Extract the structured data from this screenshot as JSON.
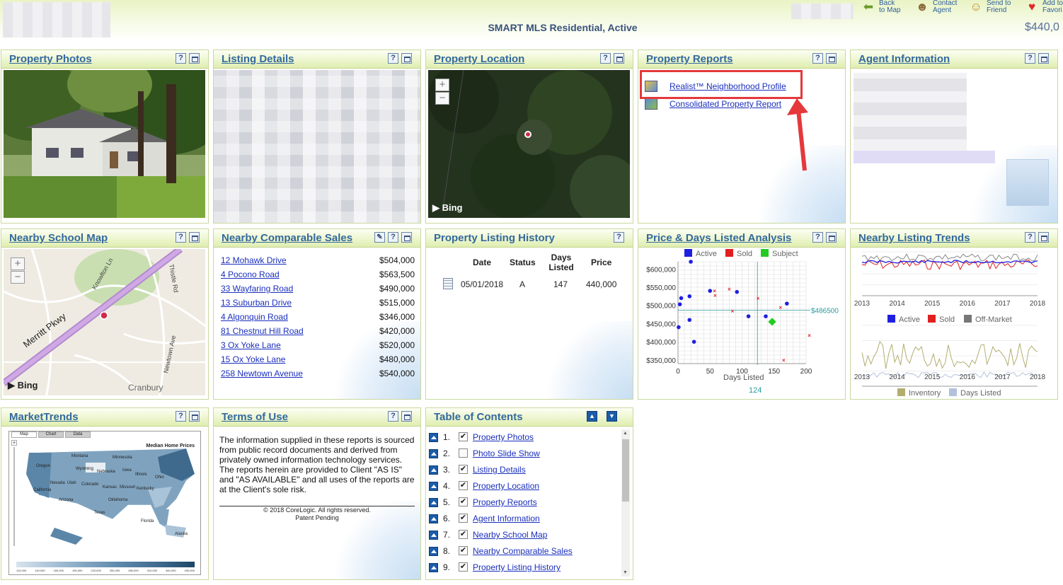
{
  "header": {
    "report_title": "SMART MLS Residential, Active",
    "price": "$440,0",
    "buttons": [
      {
        "label1": "Back",
        "label2": "to Map"
      },
      {
        "label1": "Contact",
        "label2": "Agent"
      },
      {
        "label1": "Send to",
        "label2": "Friend"
      },
      {
        "label1": "Add to",
        "label2": "Favori"
      }
    ]
  },
  "panels": {
    "property_photos": {
      "title": "Property Photos"
    },
    "listing_details": {
      "title": "Listing Details"
    },
    "property_location": {
      "title": "Property Location",
      "attribution": "Bing"
    },
    "property_reports": {
      "title": "Property Reports",
      "links": [
        "Realist™ Neighborhood Profile",
        "Consolidated Property Report"
      ]
    },
    "agent_information": {
      "title": "Agent Information"
    },
    "nearby_school_map": {
      "title": "Nearby School Map",
      "attribution": "Bing",
      "labels": [
        "Merritt Pkwy",
        "Knowlton Ln",
        "Thistle Rd",
        "Newtown Ave",
        "Cranbury"
      ]
    },
    "nearby_comparable_sales": {
      "title": "Nearby Comparable Sales",
      "rows": [
        {
          "address": "12 Mohawk Drive",
          "price": "$504,000"
        },
        {
          "address": "4 Pocono Road",
          "price": "$563,500"
        },
        {
          "address": "33 Wayfaring Road",
          "price": "$490,000"
        },
        {
          "address": "13 Suburban Drive",
          "price": "$515,000"
        },
        {
          "address": "4 Algonquin Road",
          "price": "$346,000"
        },
        {
          "address": "81 Chestnut Hill Road",
          "price": "$420,000"
        },
        {
          "address": "3 Ox Yoke Lane",
          "price": "$520,000"
        },
        {
          "address": "15 Ox Yoke Lane",
          "price": "$480,000"
        },
        {
          "address": "258 Newtown Avenue",
          "price": "$540,000"
        }
      ]
    },
    "property_listing_history": {
      "title": "Property Listing History",
      "columns": [
        "Date",
        "Status",
        "Days Listed",
        "Price"
      ],
      "row": {
        "date": "05/01/2018",
        "status": "A",
        "days": "147",
        "price": "440,000"
      }
    },
    "price_days_analysis": {
      "title": "Price & Days Listed Analysis"
    },
    "nearby_listing_trends": {
      "title": "Nearby Listing Trends"
    },
    "market_trends": {
      "title": "MarketTrends",
      "tabs": [
        "Map",
        "Chart",
        "Data"
      ],
      "map_title": "Median Home Prices",
      "states": [
        "Montana",
        "Minnesota",
        "Oregon",
        "Wyoming",
        "Nebraska",
        "Iowa",
        "Illinois",
        "Ohio",
        "Nevada",
        "Utah",
        "Colorado",
        "Kansas",
        "Missouri",
        "Kentucky",
        "California",
        "Arizona",
        "Oklahoma",
        "Texas",
        "Florida",
        "Alaska"
      ],
      "scale": [
        "110,000",
        "140,000",
        "160,000",
        "190,000",
        "220,000",
        "250,000",
        "280,000",
        "310,000",
        "340,000",
        "430,000"
      ]
    },
    "terms_of_use": {
      "title": "Terms of Use",
      "text": "The information supplied in these reports is sourced from public record documents and derived from privately owned information technology services. The reports herein are provided to Client \"AS IS\" and \"AS AVAILABLE\" and all uses of the reports are at the Client's sole risk.",
      "copyright": "© 2018 CoreLogic. All rights reserved.",
      "patent": "Patent Pending"
    },
    "table_of_contents": {
      "title": "Table of Contents",
      "items": [
        {
          "num": "1.",
          "label": "Property Photos",
          "checked": true
        },
        {
          "num": "2.",
          "label": "Photo Slide Show",
          "checked": false
        },
        {
          "num": "3.",
          "label": "Listing Details",
          "checked": true
        },
        {
          "num": "4.",
          "label": "Property Location",
          "checked": true
        },
        {
          "num": "5.",
          "label": "Property Reports",
          "checked": true
        },
        {
          "num": "6.",
          "label": "Agent Information",
          "checked": true
        },
        {
          "num": "7.",
          "label": "Nearby School Map",
          "checked": true
        },
        {
          "num": "8.",
          "label": "Nearby Comparable Sales",
          "checked": true
        },
        {
          "num": "9.",
          "label": "Property Listing History",
          "checked": true
        }
      ]
    }
  },
  "chart_data": [
    {
      "type": "scatter",
      "title": "Price & Days Listed Analysis",
      "legend": [
        "Active",
        "Sold",
        "Subject"
      ],
      "colors": {
        "Active": "#1f1fe0",
        "Sold": "#e02020",
        "Subject": "#22cc22"
      },
      "xlabel": "Days Listed",
      "xlim": [
        0,
        200
      ],
      "xticks": [
        "0",
        "50",
        "100",
        "150",
        "200"
      ],
      "ylim": [
        340000,
        620000
      ],
      "yticks": [
        "$600,000",
        "$550,000",
        "$500,000",
        "$450,000",
        "$400,000",
        "$350,000"
      ],
      "avg_price_label": "$486500",
      "avg_price": 486500,
      "avg_days_label": "124",
      "avg_days": 124,
      "series": [
        {
          "name": "Active",
          "points": [
            [
              20,
              633000
            ],
            [
              5,
              520000
            ],
            [
              3,
              503000
            ],
            [
              18,
              525000
            ],
            [
              50,
              540000
            ],
            [
              92,
              537000
            ],
            [
              1,
              440000
            ],
            [
              18,
              460000
            ],
            [
              25,
              400000
            ],
            [
              110,
              470000
            ],
            [
              137,
              470000
            ],
            [
              170,
              505000
            ]
          ]
        },
        {
          "name": "Sold",
          "points": [
            [
              58,
              528000
            ],
            [
              80,
              545000
            ],
            [
              57,
              540000
            ],
            [
              125,
              520000
            ],
            [
              85,
              485000
            ],
            [
              160,
              495000
            ],
            [
              205,
              418000
            ],
            [
              165,
              350000
            ]
          ]
        },
        {
          "name": "Subject",
          "points": [
            [
              147,
              455000
            ]
          ]
        }
      ]
    },
    {
      "type": "line",
      "title": "Nearby Listing Trends",
      "legend_top": [
        "Active",
        "Sold",
        "Off-Market"
      ],
      "legend_bottom": [
        "Inventory",
        "Days Listed"
      ],
      "x_ticks": [
        "2013",
        "2014",
        "2015",
        "2016",
        "2017",
        "2018"
      ]
    }
  ]
}
